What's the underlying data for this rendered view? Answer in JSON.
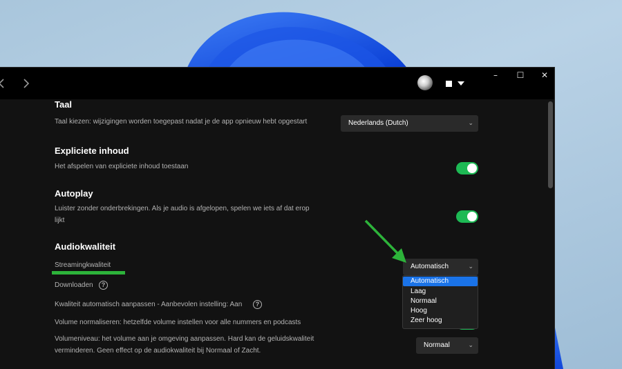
{
  "titlebar": {
    "back_icon": "chevron-left-icon",
    "forward_icon": "chevron-right-icon",
    "minimize": "–",
    "maximize": "☐",
    "close": "✕"
  },
  "settings": {
    "language": {
      "title": "Taal",
      "description": "Taal kiezen: wijzigingen worden toegepast nadat je de app opnieuw hebt opgestart",
      "value": "Nederlands (Dutch)"
    },
    "explicit": {
      "title": "Expliciete inhoud",
      "description": "Het afspelen van expliciete inhoud toestaan",
      "enabled": true
    },
    "autoplay": {
      "title": "Autoplay",
      "description_line1": "Luister zonder onderbrekingen. Als je audio is afgelopen, spelen we iets af dat erop",
      "description_line2": "lijkt",
      "enabled": true
    },
    "audio_quality": {
      "title": "Audiokwaliteit",
      "streaming_label": "Streamingkwaliteit",
      "streaming_value": "Automatisch",
      "streaming_options": [
        "Automatisch",
        "Laag",
        "Normaal",
        "Hoog",
        "Zeer hoog"
      ],
      "download_label": "Downloaden",
      "auto_adjust_label": "Kwaliteit automatisch aanpassen - Aanbevolen instelling: Aan",
      "normalize_label": "Volume normaliseren: hetzelfde volume instellen voor alle nummers en podcasts",
      "volume_level_line1": "Volumeniveau: het volume aan je omgeving aanpassen. Hard kan de geluidskwaliteit",
      "volume_level_line2": "verminderen. Geen effect op de audiokwaliteit bij Normaal of Zacht.",
      "volume_level_value": "Normaal"
    }
  },
  "colors": {
    "accent_green": "#1db954",
    "annotation_green": "#2db33a",
    "selection_blue": "#1a73e8"
  },
  "help_glyph": "?",
  "chevron_glyph": "⌄"
}
